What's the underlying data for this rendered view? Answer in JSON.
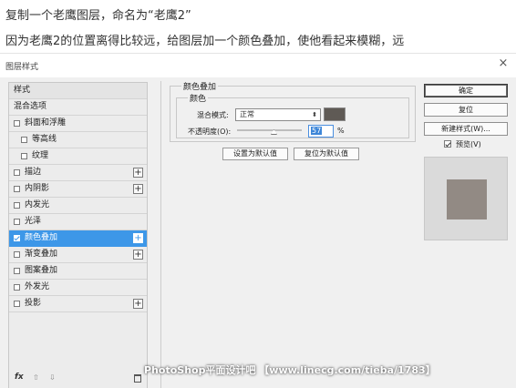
{
  "intro": {
    "line1": "复制一个老鹰图层，命名为“老鹰2”",
    "line2": "因为老鹰2的位置离得比较远，给图层加一个颜色叠加，使他看起来模糊，远"
  },
  "dialog": {
    "title": "图层样式",
    "close": "×"
  },
  "styles_panel": {
    "header": "样式",
    "blend_options": "混合选项",
    "items": [
      {
        "label": "斜面和浮雕",
        "checked": false,
        "has_plus": false
      },
      {
        "label": "等高线",
        "checked": false,
        "has_plus": false
      },
      {
        "label": "纹理",
        "checked": false,
        "has_plus": false
      },
      {
        "label": "描边",
        "checked": false,
        "has_plus": true
      },
      {
        "label": "内阴影",
        "checked": false,
        "has_plus": true
      },
      {
        "label": "内发光",
        "checked": false,
        "has_plus": false
      },
      {
        "label": "光泽",
        "checked": false,
        "has_plus": false
      },
      {
        "label": "颜色叠加",
        "checked": true,
        "has_plus": true,
        "selected": true
      },
      {
        "label": "渐变叠加",
        "checked": false,
        "has_plus": true
      },
      {
        "label": "图案叠加",
        "checked": false,
        "has_plus": false
      },
      {
        "label": "外发光",
        "checked": false,
        "has_plus": false
      },
      {
        "label": "投影",
        "checked": false,
        "has_plus": true
      }
    ],
    "plus_glyph": "+",
    "footer": {
      "fx": "fx",
      "up": "⇧",
      "down": "⇩"
    }
  },
  "color_overlay": {
    "group_title": "颜色叠加",
    "sub_title": "颜色",
    "blend_mode_label": "混合模式:",
    "blend_mode_value": "正常",
    "overlay_color": "#5f5a55",
    "opacity_label": "不透明度(O):",
    "opacity_value": "57",
    "opacity_unit": "%",
    "set_default": "设置为默认值",
    "reset_default": "复位为默认值"
  },
  "actions": {
    "ok": "确定",
    "reset": "复位",
    "new_style": "新建样式(W)...",
    "preview_label": "预览(V)",
    "preview_checked": true,
    "preview_color": "#928a84"
  },
  "watermark": "PhotoShop平面设计吧 【www.linecg.com/tieba/1783】"
}
